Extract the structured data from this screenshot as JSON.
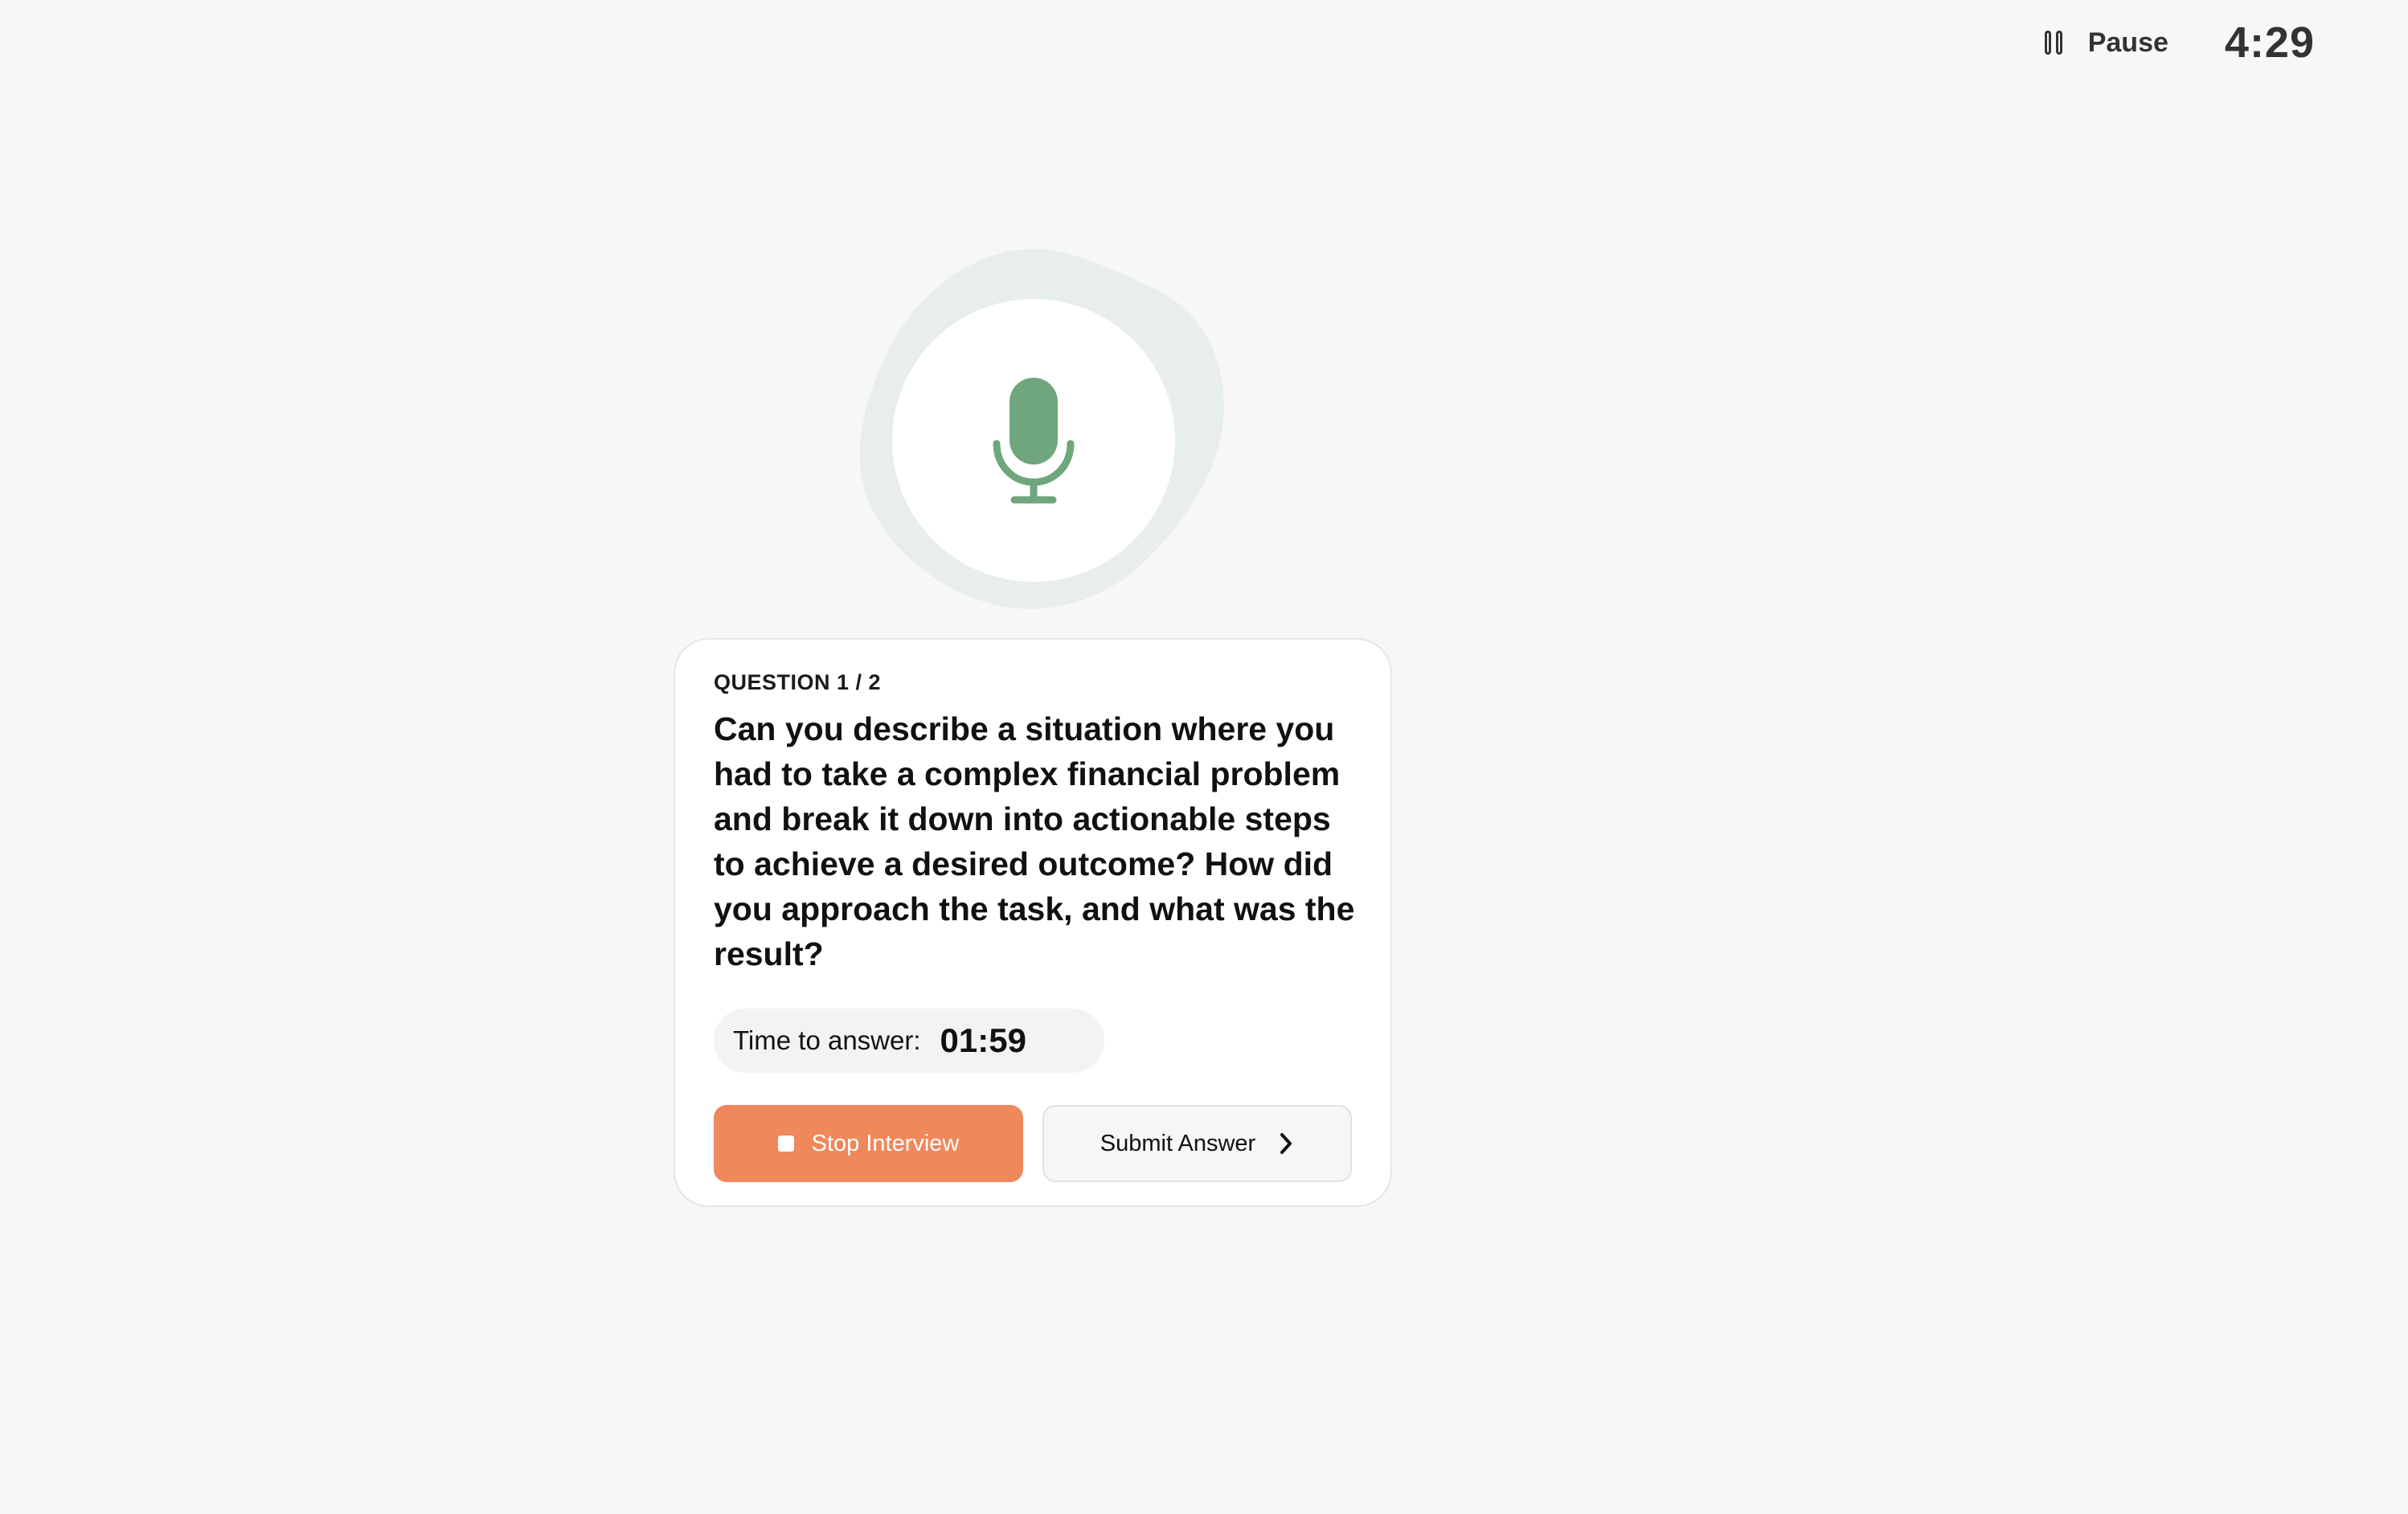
{
  "header": {
    "pause_label": "Pause",
    "total_timer": "4:29"
  },
  "question": {
    "counter": "QUESTION 1 / 2",
    "text": "Can you describe a situation where you had to take a complex financial problem and break it down into actionable steps to achieve a desired outcome? How did you approach the task, and what was the result?"
  },
  "answer_timer": {
    "label": "Time to answer:",
    "value": "01:59"
  },
  "actions": {
    "stop_label": "Stop Interview",
    "submit_label": "Submit Answer"
  },
  "colors": {
    "background": "#f7f7f7",
    "accent_stop": "#ef885b",
    "mic_green": "#6fa67d",
    "mic_halo": "#e8eee9"
  },
  "icons": {
    "pause": "pause-icon",
    "microphone": "microphone-icon",
    "stop": "stop-icon",
    "submit": "chevron-right-icon"
  }
}
